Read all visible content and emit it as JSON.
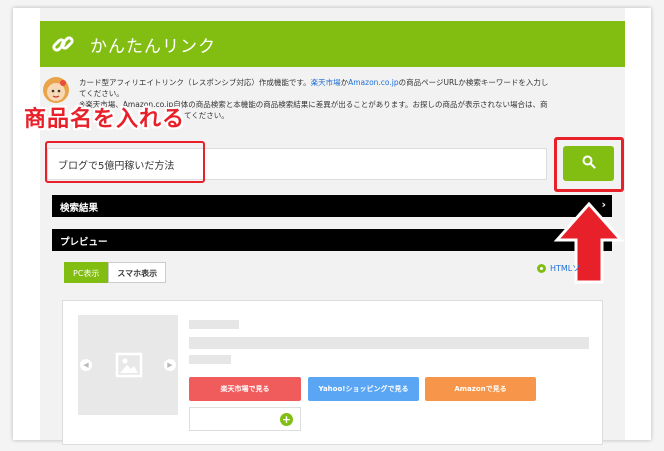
{
  "header": {
    "title": "かんたんリンク",
    "icon": "link-icon"
  },
  "description": {
    "line1_prefix": "カード型アフィリエイトリンク（レスポンシブ対応）作成機能です。",
    "line1_link1": "楽天市場",
    "line1_mid": "か",
    "line1_link2": "Amazon.co.jp",
    "line1_suffix": "の商品ページURLか検索キーワードを入力し",
    "line2": "てください。",
    "line3": "※楽天市場、Amazon.co.jp自体の商品検索と本機能の商品検索結果に差異が出ることがあります。お探しの商品が表示されない場合は、商",
    "line4": "品　　　　　　　カ　　　　　てください。"
  },
  "annotation": {
    "text": "商品名を入れる",
    "color": "#e8202a"
  },
  "search": {
    "value": "ブログで5億円稼いだ方法",
    "button_icon": "search-icon"
  },
  "sections": {
    "results": "検索結果",
    "preview": "プレビュー"
  },
  "preview": {
    "tabs": [
      {
        "label": "PC表示",
        "active": true
      },
      {
        "label": "スマホ表示",
        "active": false
      }
    ],
    "html_link": "HTMLソ"
  },
  "card": {
    "buttons": {
      "rakuten": "楽天市場で見る",
      "yahoo": "Yahoo!ショッピングで見る",
      "amazon": "Amazonで見る"
    }
  },
  "colors": {
    "accent": "#82be12",
    "annotation_red": "#e8202a"
  }
}
